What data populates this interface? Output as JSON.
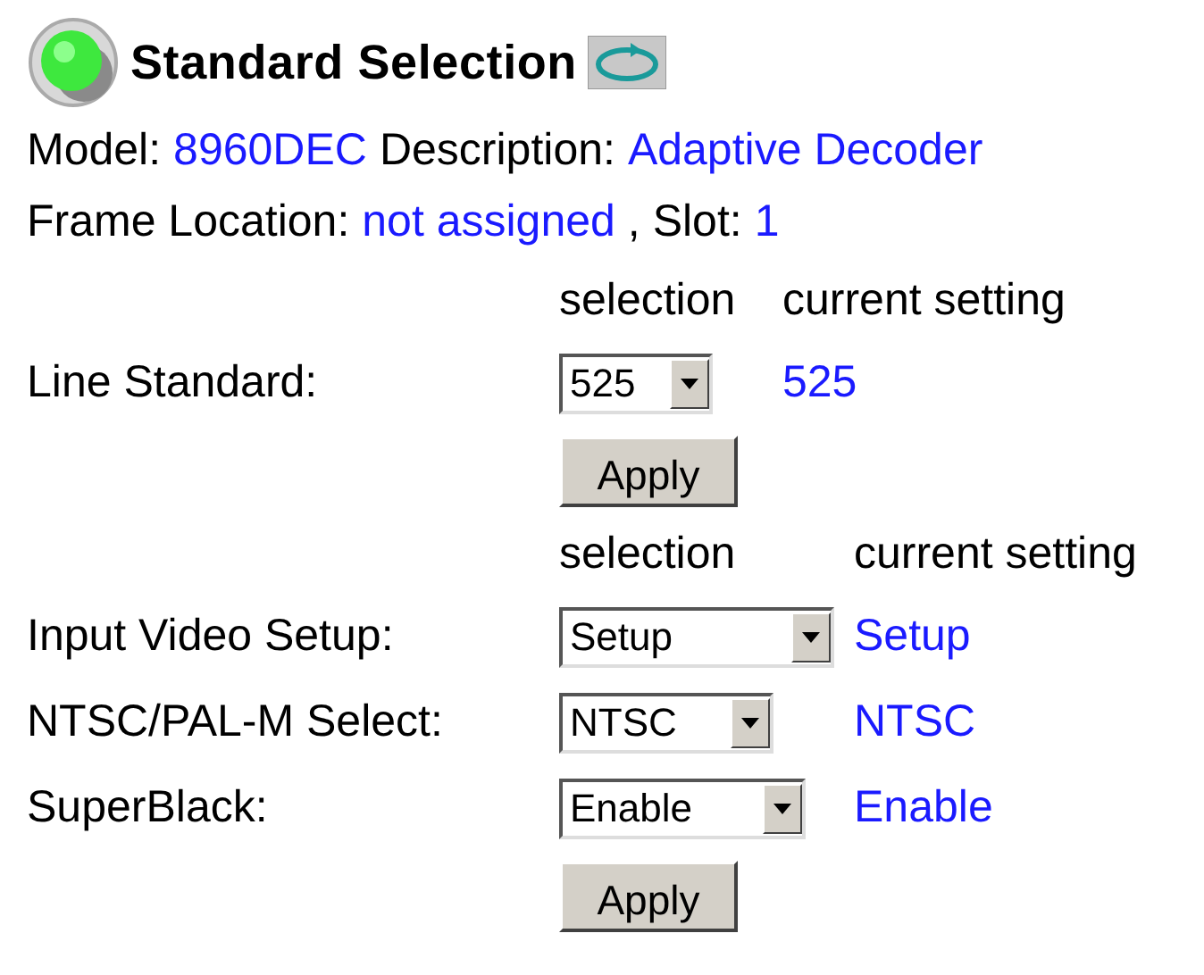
{
  "title": "Standard Selection",
  "info": [
    {
      "label": "Model:",
      "value": "8960DEC"
    },
    {
      "label": "Description:",
      "value": "Adaptive Decoder"
    }
  ],
  "location": [
    {
      "label": "Frame Location:",
      "value": "not assigned"
    },
    {
      "label": ", Slot:",
      "value": "1"
    }
  ],
  "sections": [
    {
      "headers": [
        "selection",
        "current setting"
      ],
      "rows": [
        {
          "label": "Line Standard:",
          "selection": "525",
          "current": "525"
        }
      ],
      "button": "Apply"
    },
    {
      "headers": [
        "selection",
        "current setting"
      ],
      "rows": [
        {
          "label": "Input Video Setup:",
          "selection": "Setup",
          "current": "Setup"
        },
        {
          "label": "NTSC/PAL-M Select:",
          "selection": "NTSC",
          "current": "NTSC"
        },
        {
          "label": "SuperBlack:",
          "selection": "Enable",
          "current": "Enable"
        }
      ],
      "button": "Apply"
    }
  ]
}
